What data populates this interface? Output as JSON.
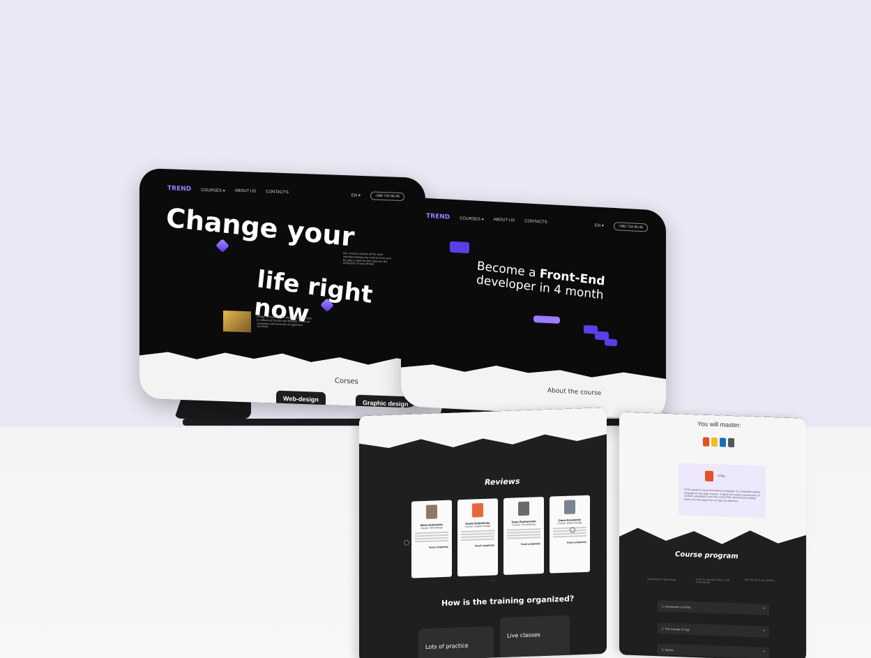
{
  "scene": {
    "colors": {
      "wall": "#ebe7f4",
      "floor": "#f6f6f6",
      "device": "#0b0b0c",
      "accent": "#9d7bff"
    }
  },
  "tablet_left": {
    "logo": "TREND",
    "nav": [
      "COURSES ▾",
      "ABOUT US",
      "CONTACTS"
    ],
    "lang": "EN ▾",
    "phone": "+380 724 90-45",
    "headline_1": "Change your",
    "headline_2": "life right now",
    "side_text": "Our courses contain all the most important things you need to know and be able to take the first step into the profession of your dream",
    "about_text": "Design School TREND does not sell courses to millions of Russia and Belarus. Does not cooperate with terrorists of aggressor countries.",
    "section_title": "Corses",
    "course_1": "Web-design",
    "course_2": "Graphic design"
  },
  "tablet_right": {
    "logo": "TREND",
    "nav": [
      "COURSES ▾",
      "ABOUT US",
      "CONTACTS"
    ],
    "lang": "EN ▾",
    "phone": "+380 724 90-45",
    "headline_prefix": "Become a ",
    "headline_bold": "Front-End",
    "headline_suffix": "developer in 4 month",
    "section_title": "About the course"
  },
  "sheet_reviews": {
    "title": "Reviews",
    "reviews": [
      {
        "name": "Maria Sobolenko",
        "course": "Course: Web-design",
        "more": "Read completely"
      },
      {
        "name": "Daniel Rodchenko",
        "course": "Course: Graphic design",
        "more": "Read completely"
      },
      {
        "name": "Taras Dovhanenko",
        "course": "Course: 3D-modeling",
        "more": "Read completely"
      },
      {
        "name": "Diana Kovalenko",
        "course": "Course: Motion design",
        "more": "Read completely"
      }
    ],
    "pager": "• • •",
    "org_title": "How is the training organized?",
    "org_cards": [
      "Lots of practice",
      "Live classes"
    ]
  },
  "sheet_program": {
    "master_title": "You will master:",
    "html_label": "HTML",
    "html_text": "HTML stands for HyperText Markup Language. It is a standard markup language for web page creation. It allows the creation and structure of sections, paragraphs, and links using HTML elements (the building blocks of a web page) such as tags and attributes.",
    "program_title": "Course program",
    "steps": [
      "Introduction to Web design",
      "Learn to code with HTML, CSS, & JavaScript",
      "Be ready for a new position"
    ],
    "lessons": [
      "1. Introduction to HTML",
      "2. The concept of \"tag\"",
      "3. Syntax"
    ]
  }
}
